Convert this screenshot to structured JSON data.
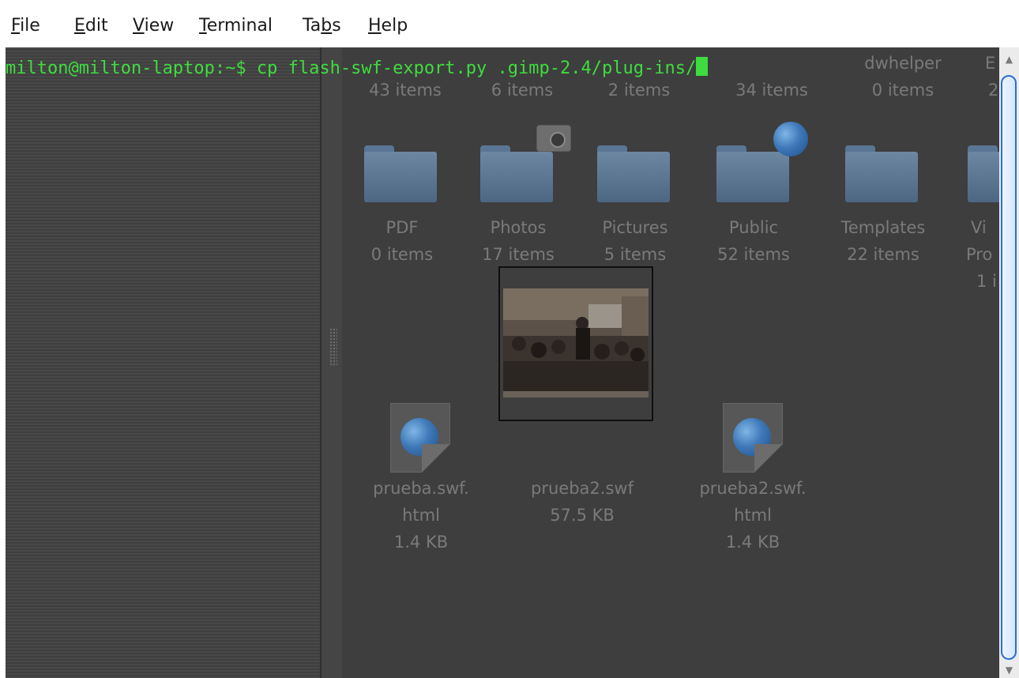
{
  "menubar": {
    "items": [
      {
        "accel": "F",
        "rest": "ile"
      },
      {
        "accel": "E",
        "rest": "dit"
      },
      {
        "accel": "V",
        "rest": "iew"
      },
      {
        "accel": "T",
        "rest": "erminal"
      },
      {
        "pre": "Ta",
        "accel": "b",
        "rest": "s"
      },
      {
        "accel": "H",
        "rest": "elp"
      }
    ]
  },
  "terminal": {
    "prompt": "milton@milton-laptop:~$ ",
    "command": "cp flash-swf-export.py .gimp-2.4/plug-ins/"
  },
  "file_manager": {
    "top_row": [
      {
        "name": "",
        "count": "43 items"
      },
      {
        "name": "",
        "count": "6 items"
      },
      {
        "name": "",
        "count": "2 items"
      },
      {
        "name": "",
        "count": "34 items"
      },
      {
        "name": "dwhelper",
        "count": "0 items"
      },
      {
        "name": "E",
        "count": "2"
      }
    ],
    "folders": [
      {
        "name": "PDF",
        "count": "0 items"
      },
      {
        "name": "Photos",
        "count": "17 items"
      },
      {
        "name": "Pictures",
        "count": "5 items"
      },
      {
        "name": "Public",
        "count": "52 items"
      },
      {
        "name": "Templates",
        "count": "22 items"
      },
      {
        "name": "Vi",
        "count": "Pro",
        "extra": "1 i"
      }
    ],
    "files": [
      {
        "name1": "prueba.swf.",
        "name2": "html",
        "size": "1.4 KB"
      },
      {
        "name1": "prueba2.swf",
        "size": "57.5 KB"
      },
      {
        "name1": "prueba2.swf.",
        "name2": "html",
        "size": "1.4 KB"
      }
    ]
  },
  "icons": {
    "folder": "folder-icon",
    "camera": "camera-emblem-icon",
    "globe": "globe-emblem-icon",
    "html_doc": "html-document-icon",
    "scroll_up": "▲",
    "scroll_down": "▼"
  },
  "colors": {
    "terminal_text": "#3fdc3f",
    "scroll_accent": "#2a6fd6"
  }
}
